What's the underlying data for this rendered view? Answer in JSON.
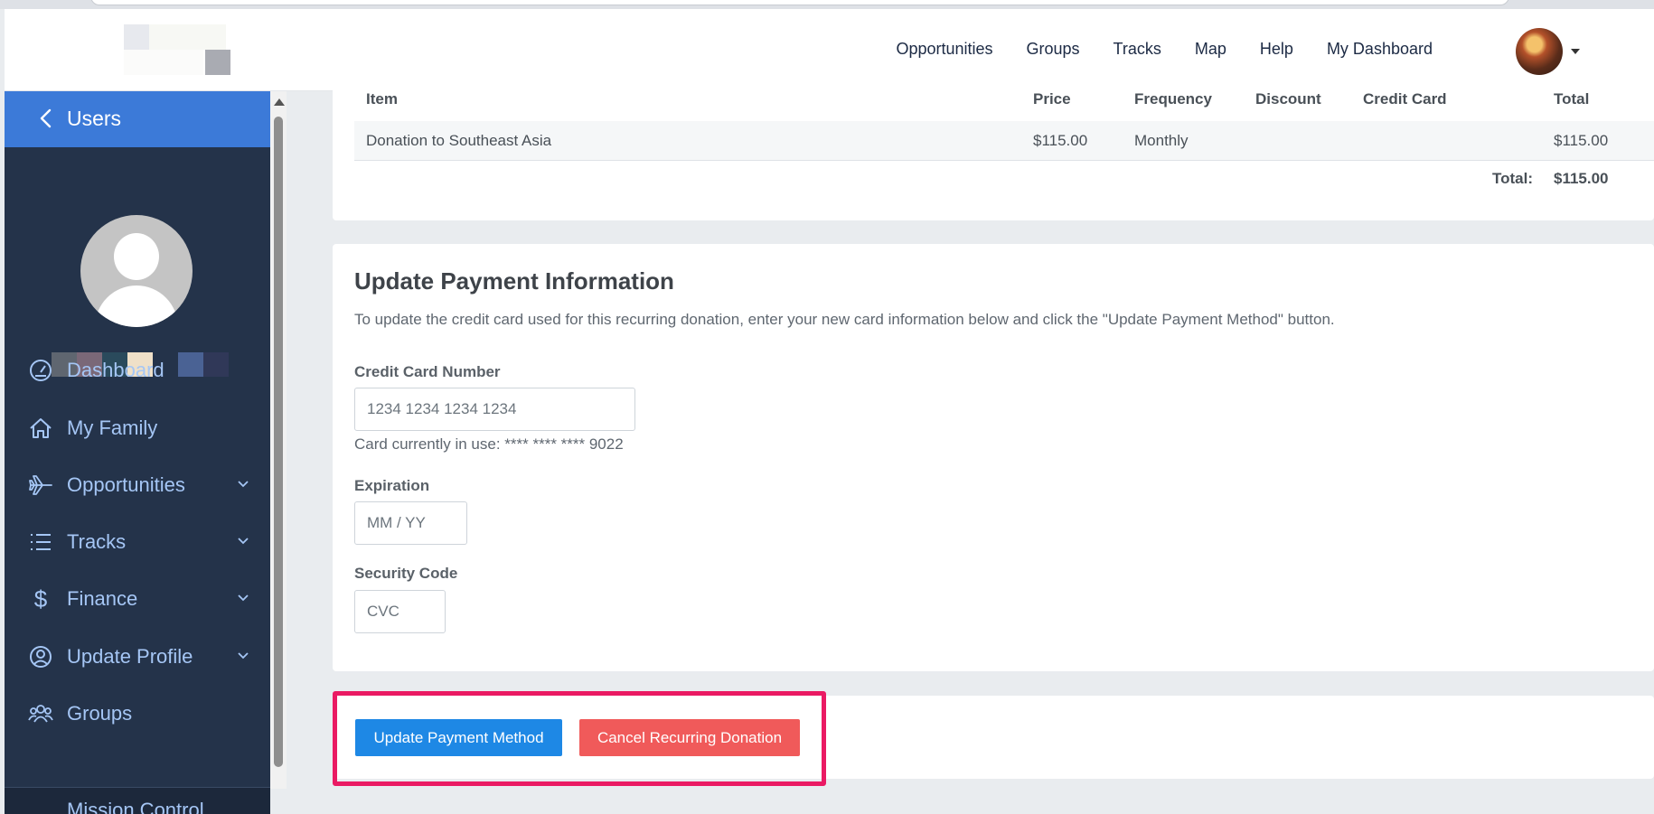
{
  "navbar": {
    "links": [
      "Opportunities",
      "Groups",
      "Tracks",
      "Map",
      "Help",
      "My Dashboard"
    ]
  },
  "sidebar": {
    "header_title": "Users",
    "items": [
      {
        "label": "Dashboard",
        "icon": "gauge-icon",
        "expandable": false
      },
      {
        "label": "My Family",
        "icon": "home-icon",
        "expandable": false
      },
      {
        "label": "Opportunities",
        "icon": "plane-icon",
        "expandable": true
      },
      {
        "label": "Tracks",
        "icon": "list-icon",
        "expandable": true
      },
      {
        "label": "Finance",
        "icon": "dollar-icon",
        "expandable": true
      },
      {
        "label": "Update Profile",
        "icon": "user-circle-icon",
        "expandable": true
      },
      {
        "label": "Groups",
        "icon": "users-icon",
        "expandable": false
      }
    ],
    "bottom_item": "Mission Control"
  },
  "order_table": {
    "headers": {
      "item": "Item",
      "price": "Price",
      "frequency": "Frequency",
      "discount": "Discount",
      "credit_card": "Credit Card",
      "total": "Total"
    },
    "rows": [
      {
        "item": "Donation to Southeast Asia",
        "price": "$115.00",
        "frequency": "Monthly",
        "discount": "",
        "credit_card": "",
        "total": "$115.00"
      }
    ],
    "total_label": "Total:",
    "total_value": "$115.00"
  },
  "payment": {
    "title": "Update Payment Information",
    "description": "To update the credit card used for this recurring donation, enter your new card information below and click the \"Update Payment Method\" button.",
    "card_number_label": "Credit Card Number",
    "card_number_placeholder": "1234 1234 1234 1234",
    "card_in_use": "Card currently in use: **** **** **** 9022",
    "expiration_label": "Expiration",
    "expiration_placeholder": "MM / YY",
    "security_label": "Security Code",
    "security_placeholder": "CVC"
  },
  "actions": {
    "update_label": "Update Payment Method",
    "cancel_label": "Cancel Recurring Donation"
  },
  "colors": {
    "sidebar_bg": "#24334a",
    "sidebar_header": "#3c7ad8",
    "primary": "#1e88e5",
    "danger": "#f05a5a",
    "highlight": "#ea1a63"
  }
}
